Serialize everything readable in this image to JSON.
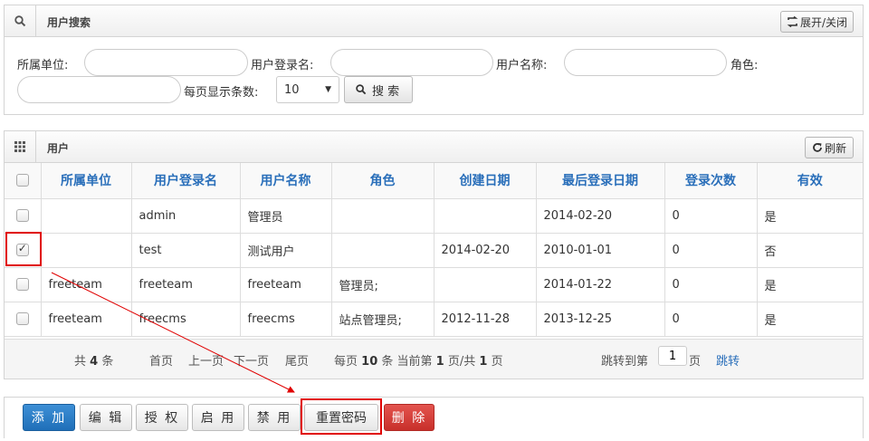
{
  "search_panel": {
    "title": "用户搜索",
    "toggle_label": "展开/关闭",
    "unit_label": "所属单位:",
    "unit_value": "",
    "login_label": "用户登录名:",
    "login_value": "",
    "name_label": "用户名称:",
    "name_value": "",
    "role_label": "角色:",
    "role_value": "",
    "pagesize_label": "每页显示条数:",
    "pagesize_value": "10",
    "search_label": "搜 索"
  },
  "table_panel": {
    "title": "用户",
    "refresh_label": "刷新",
    "columns": [
      "所属单位",
      "用户登录名",
      "用户名称",
      "角色",
      "创建日期",
      "最后登录日期",
      "登录次数",
      "有效"
    ],
    "rows": [
      {
        "unit": "",
        "login": "admin",
        "name": "管理员",
        "role": "",
        "created": "",
        "last_login": "2014-02-20",
        "count": "0",
        "valid": "是",
        "checked": false
      },
      {
        "unit": "",
        "login": "test",
        "name": "测试用户",
        "role": "",
        "created": "2014-02-20",
        "last_login": "2010-01-01",
        "count": "0",
        "valid": "否",
        "checked": true
      },
      {
        "unit": "freeteam",
        "login": "freeteam",
        "name": "freeteam",
        "role": "管理员;",
        "created": "",
        "last_login": "2014-01-22",
        "count": "0",
        "valid": "是",
        "checked": false
      },
      {
        "unit": "freeteam",
        "login": "freecms",
        "name": "freecms",
        "role": "站点管理员;",
        "created": "2012-11-28",
        "last_login": "2013-12-25",
        "count": "0",
        "valid": "是",
        "checked": false
      }
    ]
  },
  "pager": {
    "total_prefix": "共",
    "total": "4",
    "total_suffix": "条",
    "first": "首页",
    "prev": "上一页",
    "next": "下一页",
    "last": "尾页",
    "per_page_prefix": "每页",
    "per_page": "10",
    "per_page_suffix": "条 当前第",
    "current_page": "1",
    "page_sep": "页/共",
    "total_pages": "1",
    "page_suffix": "页",
    "jump_prefix": "跳转到第",
    "jump_value": "1",
    "jump_suffix": "页",
    "jump_button": "跳转"
  },
  "toolbar": {
    "add": "添 加",
    "edit": "编 辑",
    "grant": "授 权",
    "enable": "启 用",
    "disable": "禁 用",
    "reset_password": "重置密码",
    "delete": "删 除"
  },
  "colors": {
    "header_text": "#2a6fba",
    "primary": "#2272bd",
    "danger": "#d43f3a",
    "annotation": "#e00000"
  }
}
